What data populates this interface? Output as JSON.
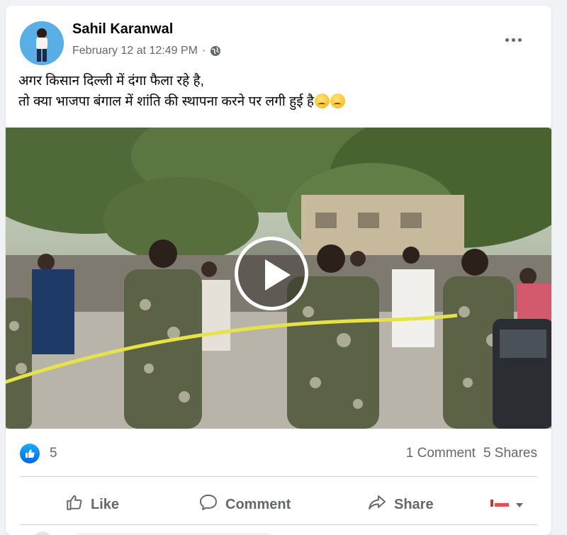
{
  "post": {
    "author": "Sahil Karanwal",
    "timestamp": "February 12 at 12:49 PM",
    "separator": "·",
    "privacy_icon": "globe-icon",
    "text_line1": "अगर किसान दिल्ली में दंगा फैला रहे है,",
    "text_line2": "तो क्या भाजपा बंगाल में शांति की स्थापना करने पर लगी हुई है",
    "emoji": "sad-face-emoji"
  },
  "video": {
    "play_icon": "play-icon"
  },
  "stats": {
    "reaction_icon": "like-reaction-icon",
    "reaction_count": "5",
    "comments": "1 Comment",
    "shares": "5 Shares"
  },
  "actions": {
    "like": "Like",
    "comment": "Comment",
    "share": "Share"
  },
  "colors": {
    "accent": "#1877f2",
    "secondary_text": "#65676b",
    "background": "#f0f2f5"
  }
}
